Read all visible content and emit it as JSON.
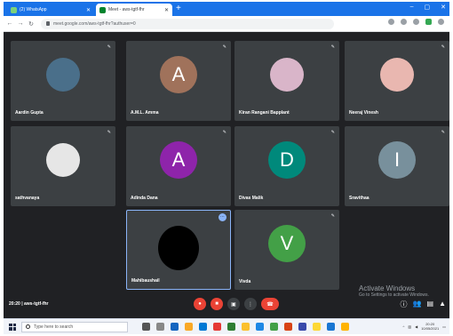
{
  "browser": {
    "tabs": [
      {
        "label": "(2) WhatsApp",
        "active": false
      },
      {
        "label": "Meet - aws-tgtf-fhr",
        "active": true
      }
    ],
    "new_tab": "+",
    "window_controls": [
      "–",
      "▢",
      "✕"
    ],
    "address": "meet.google.com/aws-tgtf-fhr?authuser=0"
  },
  "participants": [
    {
      "name": "Aardin Gupta",
      "type": "photo",
      "color": "#4a6f8a",
      "muted": true
    },
    {
      "name": "A.M.L. Amma",
      "type": "initial",
      "initial": "A",
      "color": "#a0725b",
      "muted": true
    },
    {
      "name": "Kiran Rangani Bapplant",
      "type": "photo",
      "color": "#d9b5c9",
      "muted": true
    },
    {
      "name": "Neeraj Vinesh",
      "type": "photo",
      "color": "#e9b7b0",
      "muted": true
    },
    {
      "name": "sathvanaya",
      "type": "photo",
      "color": "#e6e6e6",
      "muted": true
    },
    {
      "name": "Adinda Dana",
      "type": "initial",
      "initial": "A",
      "color": "#8e24aa",
      "muted": true
    },
    {
      "name": "Divas Malik",
      "type": "initial",
      "initial": "D",
      "color": "#00897b",
      "muted": true
    },
    {
      "name": "Sravithaa",
      "type": "initial",
      "initial": "I",
      "color": "#78909c",
      "muted": true
    },
    {
      "name": "Mahibaushail",
      "type": "photo",
      "color": "#000000",
      "muted": false,
      "selected": true
    },
    {
      "name": "Vivda",
      "type": "initial",
      "initial": "V",
      "color": "#43a047",
      "muted": true
    }
  ],
  "meeting": {
    "clock": "20:20",
    "code": "aws-tgtf-fhr",
    "separator": "|",
    "controls": [
      "mic-off",
      "camera-off",
      "present",
      "more",
      "end-call"
    ]
  },
  "watermark": {
    "title": "Activate Windows",
    "subtitle": "Go to Settings to activate Windows."
  },
  "taskbar": {
    "search_placeholder": "Type here to search",
    "time": "20:20",
    "date": "10/05/2021"
  }
}
